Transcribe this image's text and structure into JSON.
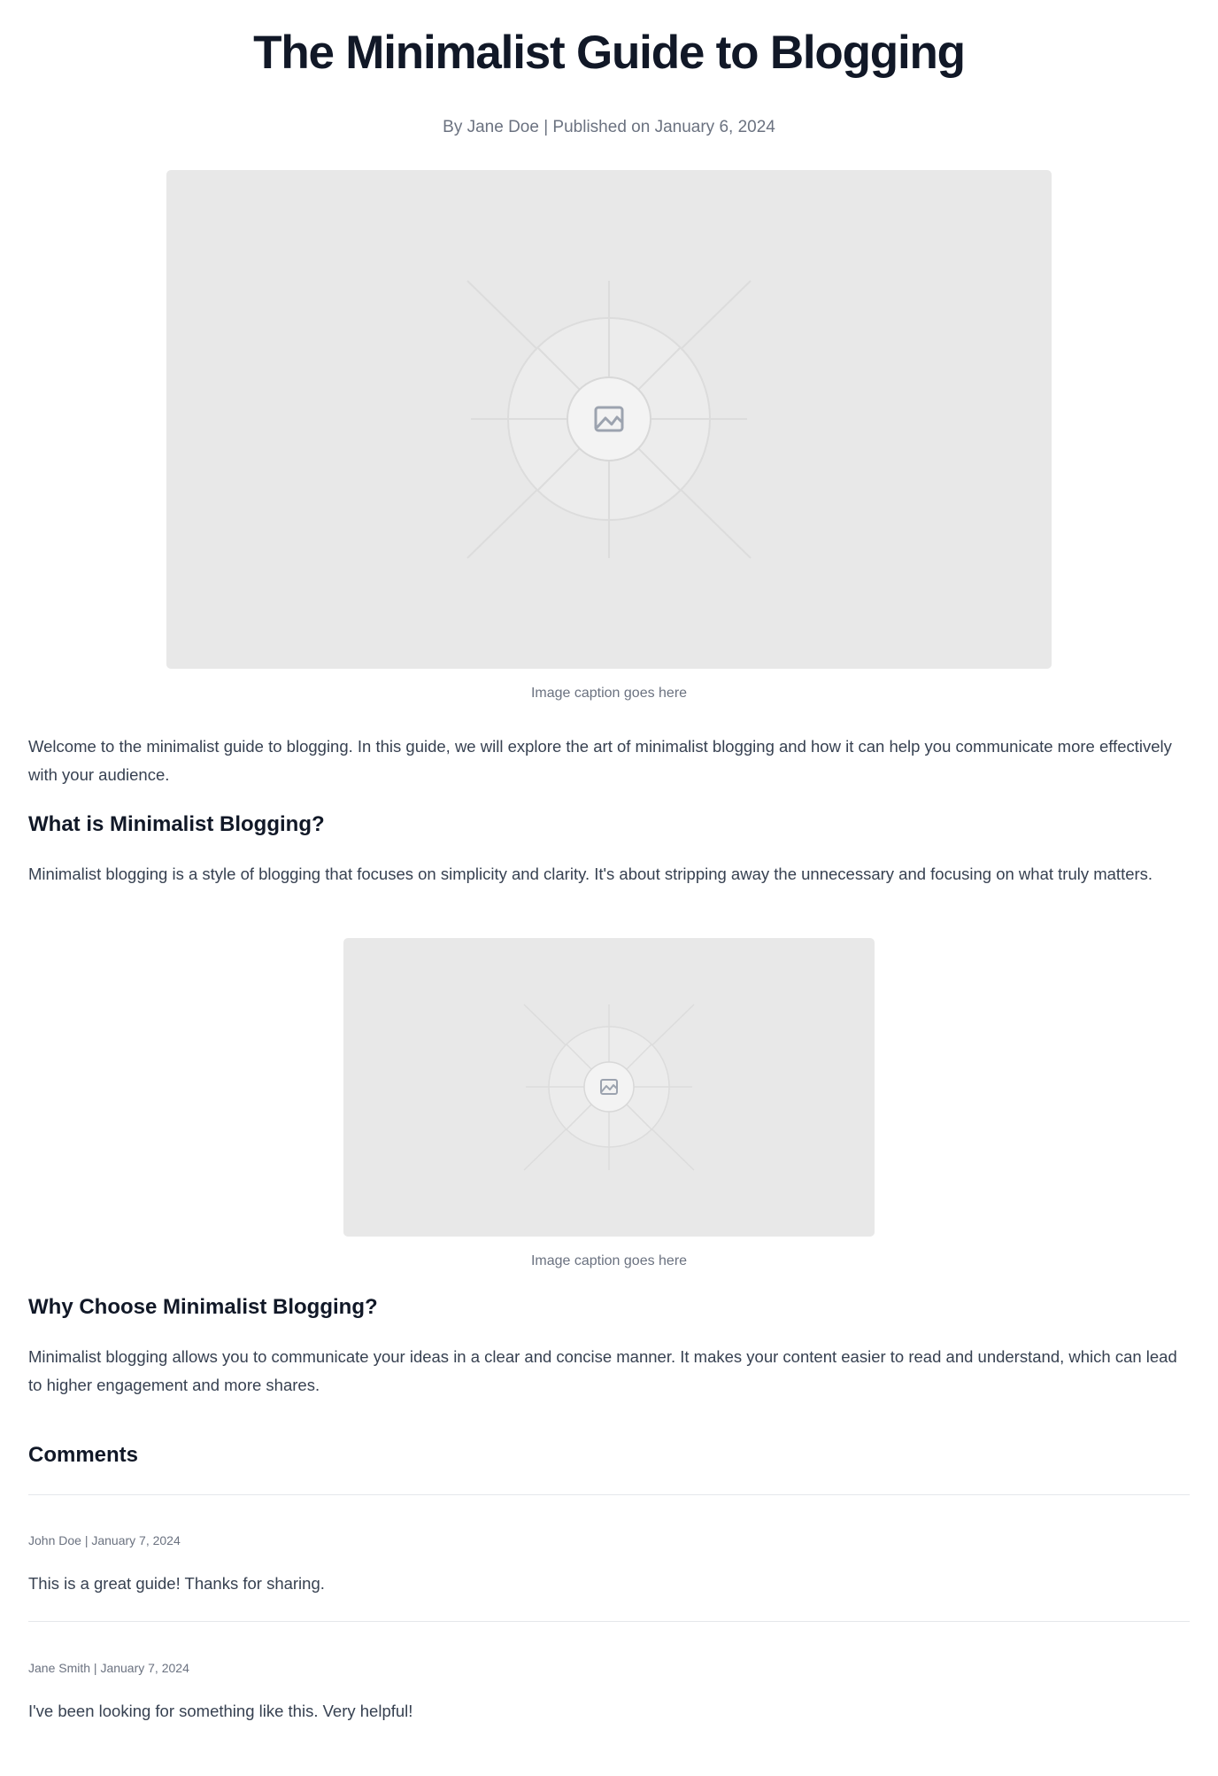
{
  "article": {
    "title": "The Minimalist Guide to Blogging",
    "byline": "By Jane Doe | Published on January 6, 2024",
    "figures": [
      {
        "caption": "Image caption goes here",
        "placeholder_icon": "image-icon"
      },
      {
        "caption": "Image caption goes here",
        "placeholder_icon": "image-icon"
      }
    ],
    "intro": "Welcome to the minimalist guide to blogging. In this guide, we will explore the art of minimalist blogging and how it can help you communicate more effectively with your audience.",
    "sections": [
      {
        "heading": "What is Minimalist Blogging?",
        "body": "Minimalist blogging is a style of blogging that focuses on simplicity and clarity. It's about stripping away the unnecessary and focusing on what truly matters."
      },
      {
        "heading": "Why Choose Minimalist Blogging?",
        "body": "Minimalist blogging allows you to communicate your ideas in a clear and concise manner. It makes your content easier to read and understand, which can lead to higher engagement and more shares."
      }
    ]
  },
  "comments": {
    "heading": "Comments",
    "items": [
      {
        "meta": "John Doe | January 7, 2024",
        "text": "This is a great guide! Thanks for sharing."
      },
      {
        "meta": "Jane Smith | January 7, 2024",
        "text": "I've been looking for something like this. Very helpful!"
      }
    ]
  },
  "colors": {
    "heading": "#111827",
    "body_text": "#374151",
    "muted_text": "#6b7280",
    "image_placeholder": "#e8e8e8",
    "divider": "#e5e7eb"
  }
}
